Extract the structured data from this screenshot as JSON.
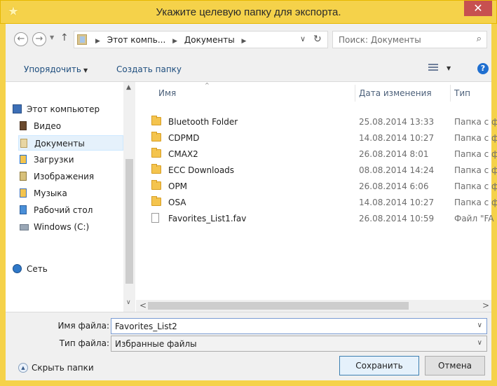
{
  "window": {
    "title": "Укажите целевую папку для экспорта.",
    "close_glyph": "✕",
    "app_icon_glyph": "★"
  },
  "navbar": {
    "back_glyph": "←",
    "forward_glyph": "→",
    "dropdown_glyph": "▼",
    "up_glyph": "↑",
    "path": [
      "Этот компь...",
      "Документы"
    ],
    "path_sep": "▶",
    "address_dropdown_glyph": "∨",
    "refresh_glyph": "↻",
    "search_placeholder": "Поиск: Документы",
    "search_glyph": "⌕"
  },
  "toolbar": {
    "organize_label": "Упорядочить",
    "new_folder_label": "Создать папку",
    "dropdown_glyph": "▼",
    "help_glyph": "?"
  },
  "sidebar": {
    "items": [
      {
        "label": "Этот компьютер",
        "icon": "computer-icon"
      },
      {
        "label": "Видео",
        "icon": "videos-icon"
      },
      {
        "label": "Документы",
        "icon": "documents-icon",
        "selected": true
      },
      {
        "label": "Загрузки",
        "icon": "downloads-icon"
      },
      {
        "label": "Изображения",
        "icon": "pictures-icon"
      },
      {
        "label": "Музыка",
        "icon": "music-icon"
      },
      {
        "label": "Рабочий стол",
        "icon": "desktop-icon"
      },
      {
        "label": "Windows (C:)",
        "icon": "drive-icon"
      },
      {
        "label": "Сеть",
        "icon": "network-icon"
      }
    ],
    "scroll_up_glyph": "▲",
    "scroll_down_glyph": "∨"
  },
  "file_list": {
    "columns": {
      "name": "Имя",
      "date": "Дата изменения",
      "type": "Тип"
    },
    "sort_glyph": "^",
    "rows": [
      {
        "name": "Bluetooth Folder",
        "date": "25.08.2014 13:33",
        "type": "Папка с ф",
        "kind": "folder"
      },
      {
        "name": "CDPMD",
        "date": "14.08.2014 10:27",
        "type": "Папка с ф",
        "kind": "folder"
      },
      {
        "name": "CMAX2",
        "date": "26.08.2014 8:01",
        "type": "Папка с ф",
        "kind": "folder"
      },
      {
        "name": "ECC Downloads",
        "date": "08.08.2014 14:24",
        "type": "Папка с ф",
        "kind": "folder"
      },
      {
        "name": "OPM",
        "date": "26.08.2014 6:06",
        "type": "Папка с ф",
        "kind": "folder"
      },
      {
        "name": "OSA",
        "date": "14.08.2014 10:27",
        "type": "Папка с ф",
        "kind": "folder"
      },
      {
        "name": "Favorites_List1.fav",
        "date": "26.08.2014 10:59",
        "type": "Файл \"FA",
        "kind": "file"
      }
    ],
    "hscroll_left_glyph": "<",
    "hscroll_right_glyph": ">"
  },
  "fields": {
    "filename_label": "Имя файла:",
    "filename_value": "Favorites_List2",
    "filetype_label": "Тип файла:",
    "filetype_value": "Избранные файлы",
    "dropdown_glyph": "∨"
  },
  "footer": {
    "hide_folders_label": "Скрыть папки",
    "hide_glyph": "▲",
    "save_label": "Сохранить",
    "cancel_label": "Отмена"
  }
}
